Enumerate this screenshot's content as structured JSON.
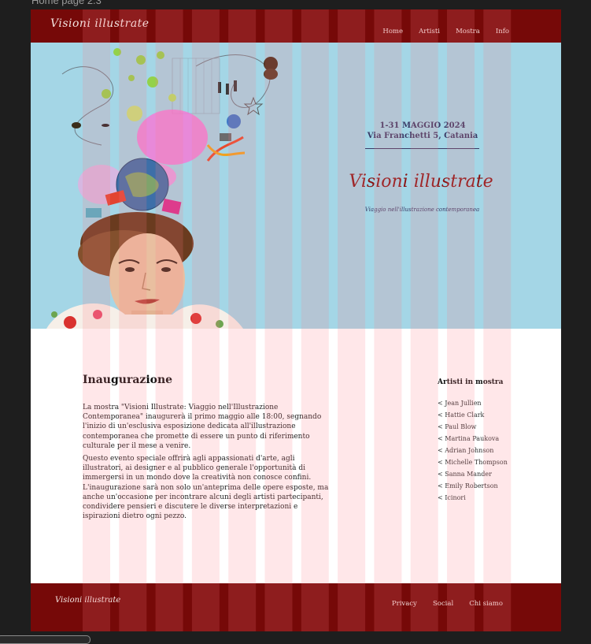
{
  "frame": {
    "label": "Home page 2.3"
  },
  "header": {
    "brand": "Visioni illustrate",
    "nav": [
      "Home",
      "Artisti",
      "Mostra",
      "Info"
    ]
  },
  "hero": {
    "date_line1": "1-31 MAGGIO 2024",
    "date_line2": "Via Franchetti 5, Catania",
    "title": "Visioni illustrate",
    "subtitle": "Viaggio nell'illustrazione contemporanea"
  },
  "inauguration": {
    "title": "Inaugurazione",
    "paragraph1": "La mostra \"Visioni Illustrate: Viaggio nell'Illustrazione Contemporanea\" inaugurerà il primo maggio alle 18:00, segnando l'inizio di un'esclusiva esposizione dedicata all'illustrazione contemporanea che promette di essere un punto di riferimento culturale per il mese a venire.",
    "paragraph2": "Questo evento speciale offrirà agli appassionati d'arte, agli illustratori, ai designer e al pubblico generale l'opportunità di immergersi in un mondo dove la creatività non conosce confini. L'inaugurazione sarà non solo un'anteprima delle opere esposte, ma anche un'occasione per incontrare alcuni degli artisti partecipanti, condividere pensieri e discutere le diverse interpretazioni e ispirazioni dietro ogni pezzo."
  },
  "artists": {
    "title": "Artisti in mostra",
    "items": [
      "< Jean Jullien",
      "< Hattie Clark",
      "< Paul Blow",
      "< Martina Paukova",
      "< Adrian Johnson",
      "< Michelle Thompson",
      "< Sanna Mander",
      "< Emily Robertson",
      "< Icinori"
    ]
  },
  "footer": {
    "brand": "Visioni illustrate",
    "nav": [
      "Privacy",
      "Social",
      "Chi siamo"
    ]
  },
  "colors": {
    "header_bg": "#760908",
    "hero_bg": "#a4d6e6",
    "accent_red": "#8a1414",
    "text_navy": "#3b3a66",
    "grid_overlay": "#ff7b86"
  }
}
